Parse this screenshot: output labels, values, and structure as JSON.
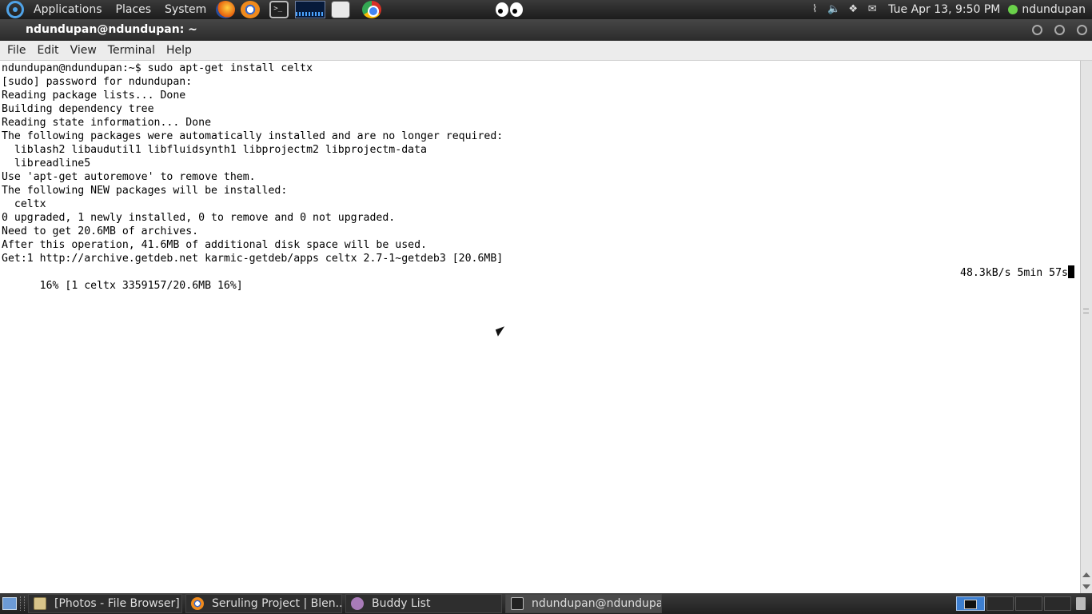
{
  "top_panel": {
    "menus": [
      "Applications",
      "Places",
      "System"
    ],
    "clock": "Tue Apr 13,  9:50 PM",
    "user": "ndundupan",
    "launchers": [
      "firefox-icon",
      "blender-icon",
      "terminal-icon",
      "system-monitor-icon",
      "screenshot-icon",
      "chrome-icon"
    ]
  },
  "window": {
    "title": "ndundupan@ndundupan: ~",
    "menu": [
      "File",
      "Edit",
      "View",
      "Terminal",
      "Help"
    ]
  },
  "terminal": {
    "lines": [
      "ndundupan@ndundupan:~$ sudo apt-get install celtx",
      "[sudo] password for ndundupan:",
      "Reading package lists... Done",
      "Building dependency tree",
      "Reading state information... Done",
      "The following packages were automatically installed and are no longer required:",
      "  liblash2 libaudutil1 libfluidsynth1 libprojectm2 libprojectm-data",
      "  libreadline5",
      "Use 'apt-get autoremove' to remove them.",
      "The following NEW packages will be installed:",
      "  celtx",
      "0 upgraded, 1 newly installed, 0 to remove and 0 not upgraded.",
      "Need to get 20.6MB of archives.",
      "After this operation, 41.6MB of additional disk space will be used.",
      "Get:1 http://archive.getdeb.net karmic-getdeb/apps celtx 2.7-1~getdeb3 [20.6MB]"
    ],
    "progress_left": "16% [1 celtx 3359157/20.6MB 16%]",
    "progress_right": "48.3kB/s 5min 57s"
  },
  "taskbar": {
    "tasks": [
      "[Photos - File Browser]",
      "Seruling Project | Blen...",
      "Buddy List",
      "ndundupan@ndundupa..."
    ]
  }
}
